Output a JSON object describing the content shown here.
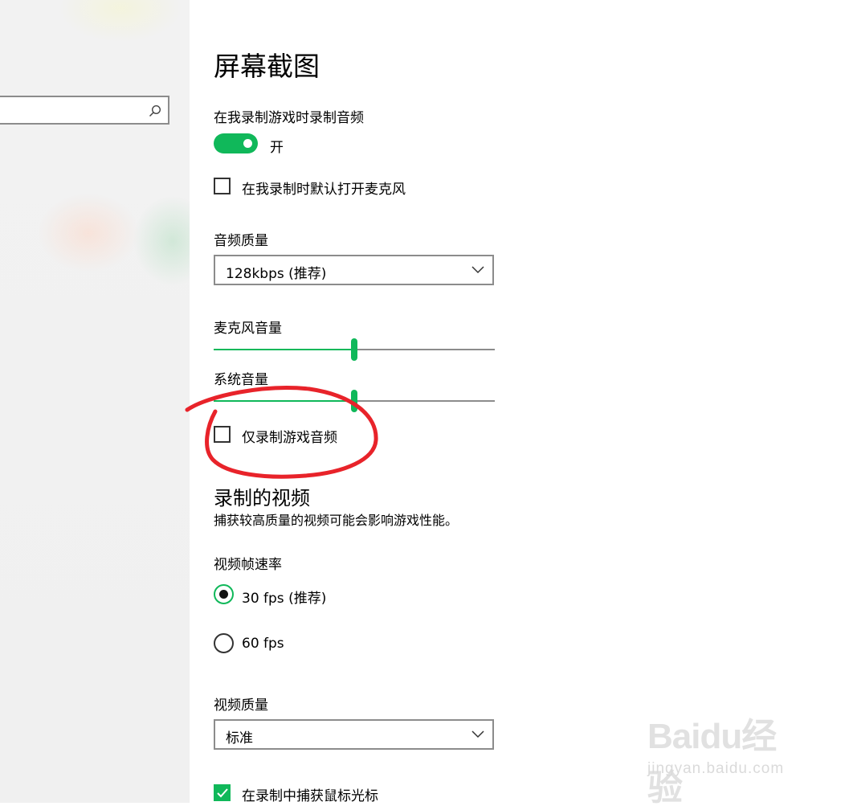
{
  "sidebar": {
    "search_placeholder": ""
  },
  "page": {
    "title": "屏幕截图"
  },
  "audio": {
    "record_audio_label": "在我录制游戏时录制音频",
    "record_audio_toggle": {
      "state": "开",
      "on": true
    },
    "mic_default_label": "在我录制时默认打开麦克风",
    "mic_default_checked": false,
    "quality_label": "音频质量",
    "quality_value": "128kbps (推荐)",
    "mic_volume_label": "麦克风音量",
    "mic_volume_level": 0.5,
    "system_volume_label": "系统音量",
    "system_volume_level": 0.5,
    "game_only_label": "仅录制游戏音频",
    "game_only_checked": false
  },
  "video": {
    "heading": "录制的视频",
    "description": "捕获较高质量的视频可能会影响游戏性能。",
    "framerate_label": "视频帧速率",
    "framerate_options": [
      {
        "label": "30 fps (推荐)",
        "selected": true
      },
      {
        "label": "60 fps",
        "selected": false
      }
    ],
    "quality_label": "视频质量",
    "quality_value": "标准",
    "capture_cursor_label": "在录制中捕获鼠标光标",
    "capture_cursor_checked": true
  },
  "colors": {
    "accent": "#10b85a",
    "annotation": "#e8232a"
  },
  "watermark": {
    "logo": "Baidu经验",
    "url": "jingyan.baidu.com"
  }
}
